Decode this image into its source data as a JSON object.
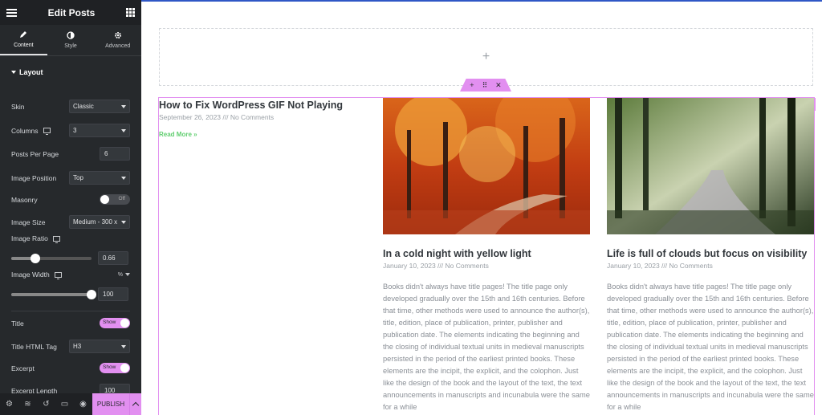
{
  "header": {
    "title": "Edit Posts"
  },
  "tabs": [
    {
      "label": "Content",
      "icon": "pencil-icon"
    },
    {
      "label": "Style",
      "icon": "contrast-icon"
    },
    {
      "label": "Advanced",
      "icon": "gear-icon"
    }
  ],
  "layout_section": {
    "title": "Layout"
  },
  "controls": {
    "skin": {
      "label": "Skin",
      "value": "Classic"
    },
    "columns": {
      "label": "Columns",
      "value": "3"
    },
    "posts_per_page": {
      "label": "Posts Per Page",
      "value": "6"
    },
    "image_position": {
      "label": "Image Position",
      "value": "Top"
    },
    "masonry": {
      "label": "Masonry",
      "value": "Off"
    },
    "image_size": {
      "label": "Image Size",
      "value": "Medium - 300 x"
    },
    "image_ratio": {
      "label": "Image Ratio",
      "value": "0.66"
    },
    "image_width": {
      "label": "Image Width",
      "unit": "%",
      "value": "100"
    },
    "title": {
      "label": "Title",
      "value": "Show"
    },
    "title_tag": {
      "label": "Title HTML Tag",
      "value": "H3"
    },
    "excerpt": {
      "label": "Excerpt",
      "value": "Show"
    },
    "excerpt_length": {
      "label": "Excerpt Length",
      "value": "100"
    }
  },
  "footer": {
    "publish_label": "PUBLISH"
  },
  "posts": [
    {
      "title": "How to Fix WordPress GIF Not Playing",
      "meta": "September 26, 2023 /// No Comments",
      "read_more": "Read More »"
    },
    {
      "title": "In a cold night with yellow light",
      "meta": "January 10, 2023 /// No Comments",
      "excerpt": "Books didn't always have title pages! The title page only developed gradually over the 15th and 16th centuries. Before that time, other methods were used to announce the author(s), title, edition, place of publication, printer, publisher and publication date. The elements indicating the beginning and the closing of individual textual units in medieval manuscripts persisted in the period of the earliest printed books. These elements are the incipit, the explicit, and the colophon. Just like the design of the book and the layout of the text, the text announcements in manuscripts and incunabula were the same for a while"
    },
    {
      "title": "Life is full of clouds but focus on visibility",
      "meta": "January 10, 2023 /// No Comments",
      "excerpt": "Books didn't always have title pages! The title page only developed gradually over the 15th and 16th centuries. Before that time, other methods were used to announce the author(s), title, edition, place of publication, printer, publisher and publication date. The elements indicating the beginning and the closing of individual textual units in medieval manuscripts persisted in the period of the earliest printed books. These elements are the incipit, the explicit, and the colophon. Just like the design of the book and the layout of the text, the text announcements in manuscripts and incunabula were the same for a while"
    }
  ],
  "colors": {
    "accent": "#e28ff0",
    "panel": "#26292c",
    "link_green": "#61ce70"
  }
}
